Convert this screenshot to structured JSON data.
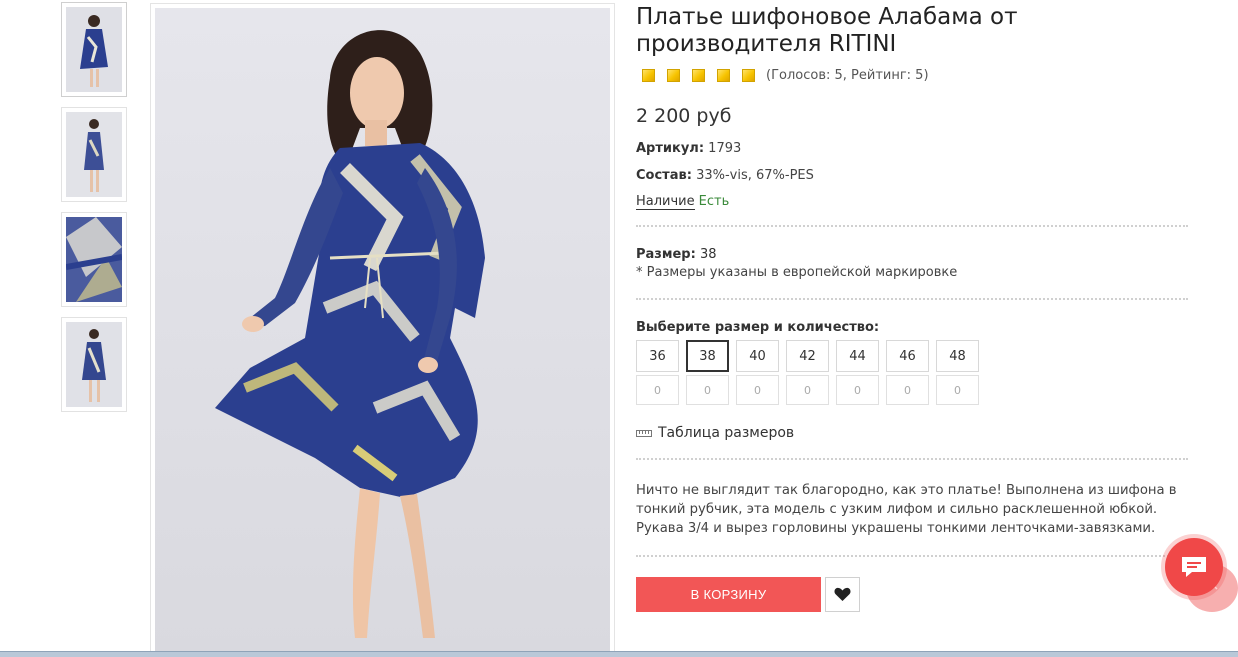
{
  "product": {
    "title": "Платье шифоновое Алабама от производителя RITINI",
    "rating": {
      "stars": 5,
      "max_stars": 5,
      "votes_text": "(Голосов: 5, Рейтинг: 5)"
    },
    "price": "2 200 руб",
    "article_label": "Артикул:",
    "article_value": "1793",
    "composition_label": "Состав:",
    "composition_value": "33%-vis, 67%-PES",
    "stock_label": "Наличие",
    "stock_value": "Есть",
    "size_label": "Размер:",
    "size_value": "38",
    "size_note": "* Размеры указаны в европейской маркировке",
    "choose_label": "Выберите размер и количество:",
    "sizes": [
      {
        "label": "36",
        "qty": "0"
      },
      {
        "label": "38",
        "qty": "0"
      },
      {
        "label": "40",
        "qty": "0"
      },
      {
        "label": "42",
        "qty": "0"
      },
      {
        "label": "44",
        "qty": "0"
      },
      {
        "label": "46",
        "qty": "0"
      },
      {
        "label": "48",
        "qty": "0"
      }
    ],
    "selected_size": "38",
    "size_table_link": "Таблица размеров",
    "description": "Ничто не выглядит так благородно, как это платье! Выполнена из шифона в тонкий рубчик, эта модель с узким лифом и сильно расклешенной юбкой. Рукава 3/4 и вырез горловины украшены тонкими ленточками-завязками.",
    "buy_label": "В КОРЗИНУ"
  },
  "colors": {
    "accent": "#f25656",
    "stock_green": "#3a8a3a",
    "star_gold": "#f7c400",
    "dress_blue": "#2b3f8f"
  },
  "icons": {
    "favorite": "heart-icon",
    "chat": "chat-icon",
    "size_table": "ruler-icon",
    "scroll_top": "chevron-up-icon"
  }
}
